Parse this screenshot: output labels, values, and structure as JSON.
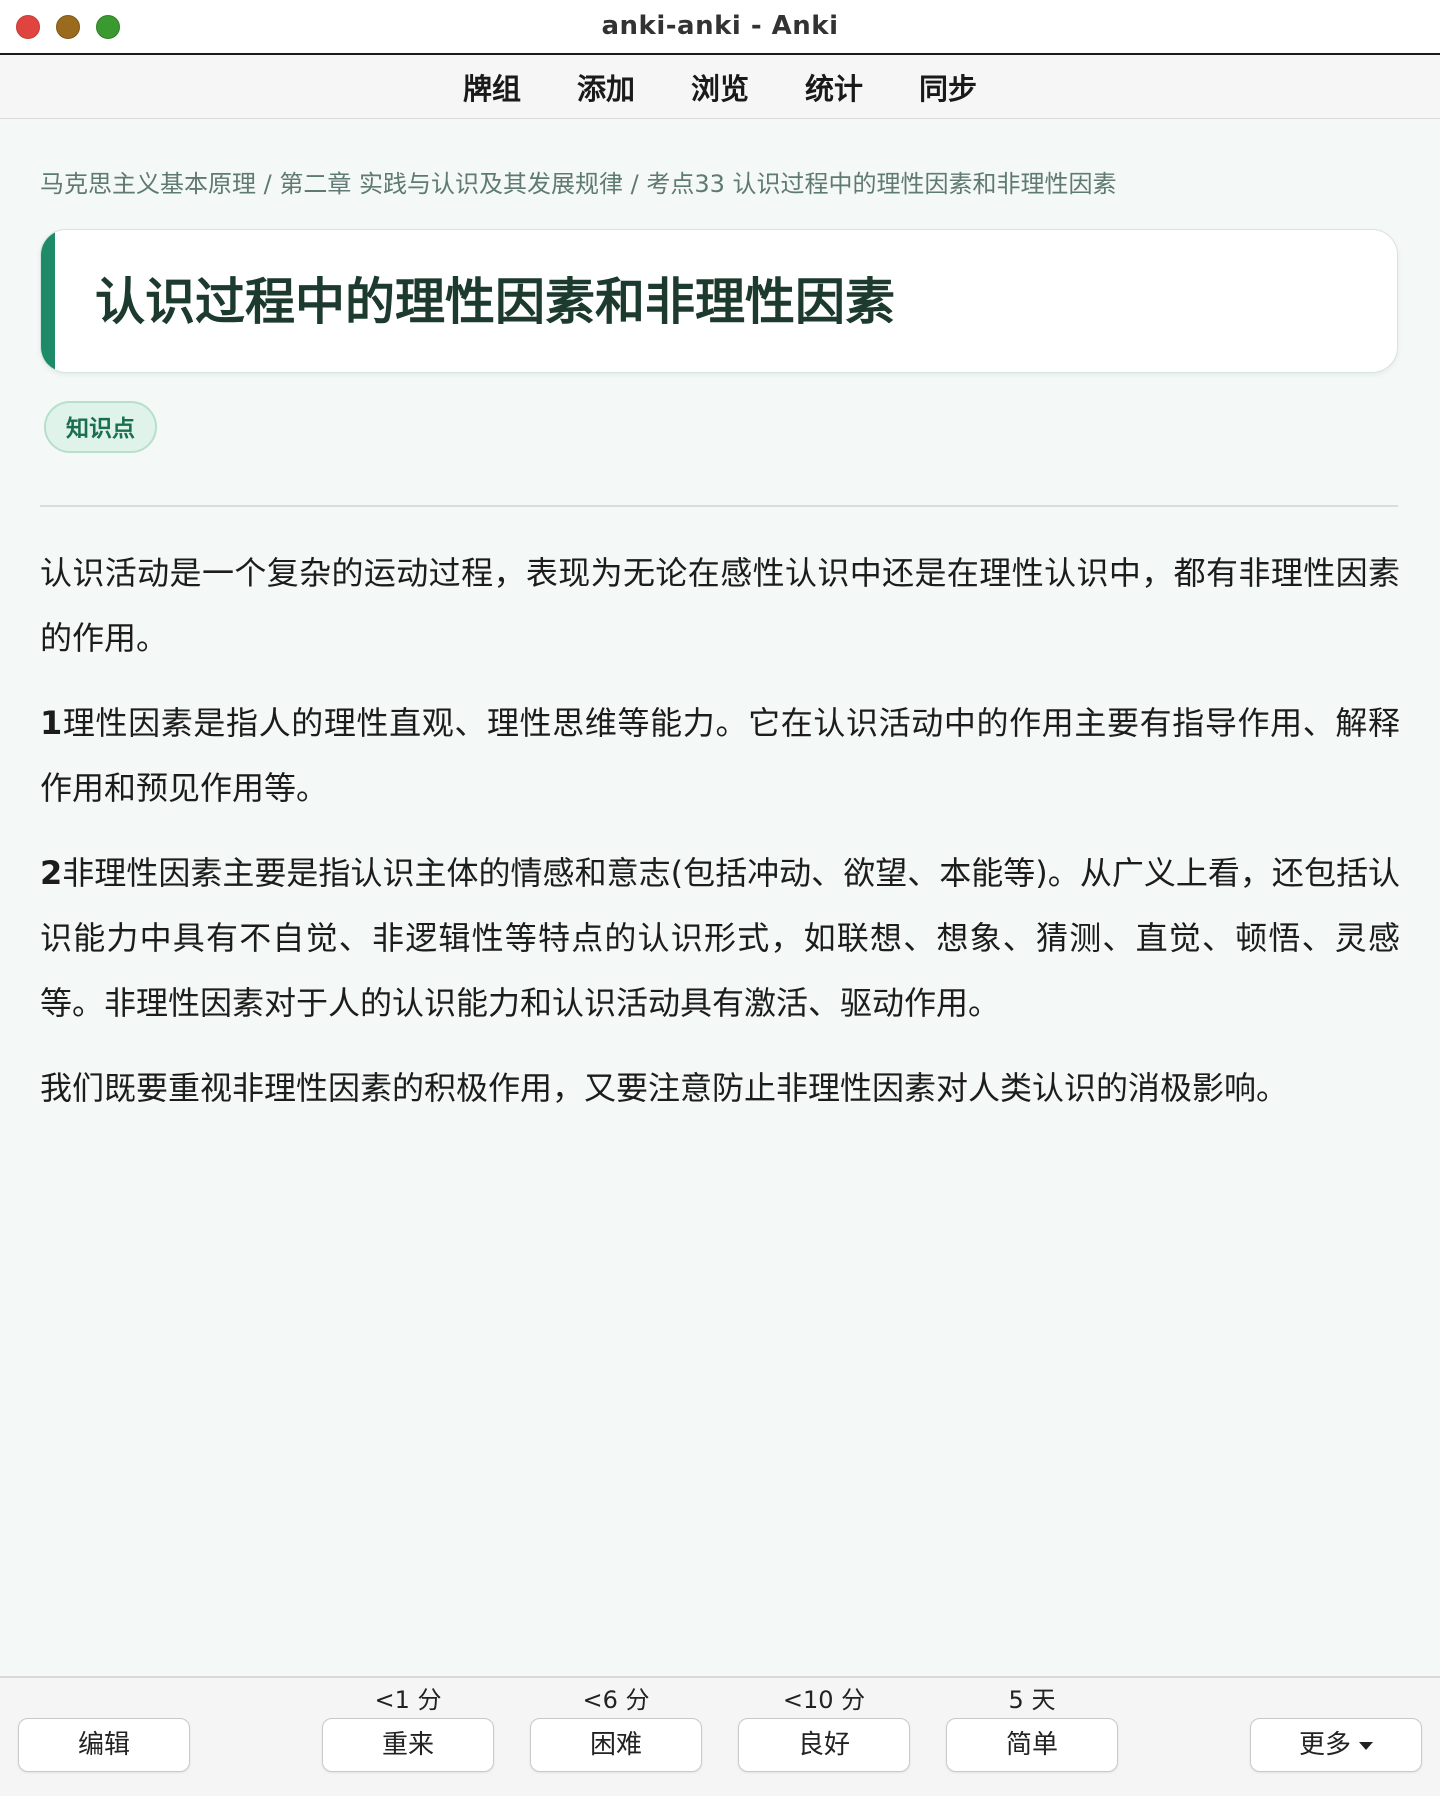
{
  "window": {
    "title": "anki-anki - Anki"
  },
  "menu": {
    "items": [
      "牌组",
      "添加",
      "浏览",
      "统计",
      "同步"
    ]
  },
  "card": {
    "breadcrumb": "马克思主义基本原理 / 第二章 实践与认识及其发展规律 / 考点33 认识过程中的理性因素和非理性因素",
    "title": "认识过程中的理性因素和非理性因素",
    "tag": "知识点",
    "paragraphs": [
      {
        "num": "",
        "text": "认识活动是一个复杂的运动过程，表现为无论在感性认识中还是在理性认识中，都有非理性因素的作用。"
      },
      {
        "num": "1",
        "text": "理性因素是指人的理性直观、理性思维等能力。它在认识活动中的作用主要有指导作用、解释作用和预见作用等。"
      },
      {
        "num": "2",
        "text": "非理性因素主要是指认识主体的情感和意志(包括冲动、欲望、本能等)。从广义上看，还包括认识能力中具有不自觉、非逻辑性等特点的认识形式，如联想、想象、猜测、直觉、顿悟、灵感等。非理性因素对于人的认识能力和认识活动具有激活、驱动作用。"
      },
      {
        "num": "",
        "text": "我们既要重视非理性因素的积极作用，又要注意防止非理性因素对人类认识的消极影响。"
      }
    ]
  },
  "bottom": {
    "edit_label": "编辑",
    "more_label": "更多",
    "answers": [
      {
        "interval": "<1 分",
        "label": "重来"
      },
      {
        "interval": "<6 分",
        "label": "困难"
      },
      {
        "interval": "<10 分",
        "label": "良好"
      },
      {
        "interval": "5 天",
        "label": "简单"
      }
    ]
  },
  "colors": {
    "accent": "#1f8a68",
    "tag_bg": "#dff3ea",
    "title_text": "#1d3a2f"
  }
}
